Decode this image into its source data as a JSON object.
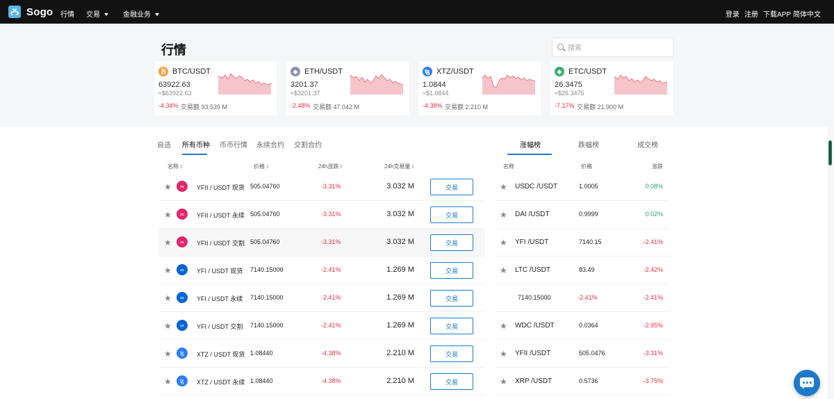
{
  "nav": {
    "brand": "Sogo",
    "items": [
      {
        "label": "行情",
        "caret": false
      },
      {
        "label": "交易",
        "caret": true
      },
      {
        "label": "金融业务",
        "caret": true
      }
    ],
    "right": [
      "登录",
      "注册",
      "下载APP",
      "简体中文"
    ]
  },
  "page": {
    "title": "行情",
    "search_placeholder": "搜索"
  },
  "cards": [
    {
      "pair": "BTC/USDT",
      "price": "63922.63",
      "cny": "≈$63922.63",
      "change": "-4.34%",
      "volume": "交易额 93.539 M",
      "icon": "bitcoin-icon",
      "icon_color": "#f2a13b"
    },
    {
      "pair": "ETH/USDT",
      "price": "3201.37",
      "cny": "≈$3201.37",
      "change": "-2.48%",
      "volume": "交易额 47.042 M",
      "icon": "ethereum-icon",
      "icon_color": "#8a92b2"
    },
    {
      "pair": "XTZ/USDT",
      "price": "1.0844",
      "cny": "≈$1.0844",
      "change": "-4.38%",
      "volume": "交易额 2.210 M",
      "icon": "tezos-icon",
      "icon_color": "#2c7df7"
    },
    {
      "pair": "ETC/USDT",
      "price": "26.3475",
      "cny": "≈$26.3475",
      "change": "-7.17%",
      "volume": "交易额 21.900 M",
      "icon": "etc-icon",
      "icon_color": "#33b073"
    }
  ],
  "tabs": [
    "自选",
    "所有币种",
    "币币行情",
    "永续合约",
    "交割合约"
  ],
  "table": {
    "headers": {
      "name": "名称",
      "price": "价格",
      "change": "24h涨跌",
      "volume": "24h交易量"
    },
    "trade_label": "交易",
    "rows": [
      {
        "pair": "YFII / USDT 现货",
        "price": "505.04760",
        "change": "-3.31%",
        "volume": "3.032 M",
        "icon": "yfii-icon",
        "icon_color": "#e0266e"
      },
      {
        "pair": "YFII / USDT 永续",
        "price": "505.04760",
        "change": "-3.31%",
        "volume": "3.032 M",
        "icon": "yfii-icon",
        "icon_color": "#e0266e"
      },
      {
        "pair": "YFII / USDT 交割",
        "price": "505.04760",
        "change": "-3.31%",
        "volume": "3.032 M",
        "icon": "yfii-icon",
        "icon_color": "#e0266e"
      },
      {
        "pair": "YFI / USDT 现货",
        "price": "7140.15000",
        "change": "-2.41%",
        "volume": "1.269 M",
        "icon": "yfi-icon",
        "icon_color": "#0064d2"
      },
      {
        "pair": "YFI / USDT 永续",
        "price": "7140.15000",
        "change": "-2.41%",
        "volume": "1.269 M",
        "icon": "yfi-icon",
        "icon_color": "#0064d2"
      },
      {
        "pair": "YFI / USDT 交割",
        "price": "7140.15000",
        "change": "-2.41%",
        "volume": "1.269 M",
        "icon": "yfi-icon",
        "icon_color": "#0064d2"
      },
      {
        "pair": "XTZ / USDT 现货",
        "price": "1.08440",
        "change": "-4.38%",
        "volume": "2.210 M",
        "icon": "tezos-icon",
        "icon_color": "#2c7df7"
      },
      {
        "pair": "XTZ / USDT 永续",
        "price": "1.08440",
        "change": "-4.38%",
        "volume": "2.210 M",
        "icon": "tezos-icon",
        "icon_color": "#2c7df7"
      }
    ]
  },
  "ranks": {
    "tabs": [
      "涨幅榜",
      "跌幅榜",
      "成交榜"
    ],
    "headers": {
      "name": "名称",
      "price": "价格",
      "change": "涨跌"
    },
    "rows": [
      {
        "name": "USDC /USDT",
        "price": "1.0005",
        "change": "0.08%",
        "dir": "up",
        "star": true
      },
      {
        "name": "DAI /USDT",
        "price": "0.9999",
        "change": "0.02%",
        "dir": "up",
        "star": true
      },
      {
        "name": "YFI /USDT",
        "price": "7140.15",
        "change": "-2.41%",
        "dir": "down",
        "star": true
      },
      {
        "name": "LTC /USDT",
        "price": "83.49",
        "change": "-2.42%",
        "dir": "down",
        "star": true
      },
      {
        "name": "7140.15000",
        "price": "-2.41%",
        "change": "-2.41%",
        "dir": "down",
        "star": false
      },
      {
        "name": "WDC /USDT",
        "price": "0.0364",
        "change": "-2.95%",
        "dir": "down",
        "star": true
      },
      {
        "name": "YFII /USDT",
        "price": "505.0476",
        "change": "-3.31%",
        "dir": "down",
        "star": true
      },
      {
        "name": "XRP /USDT",
        "price": "0.5736",
        "change": "-3.75%",
        "dir": "down",
        "star": true
      }
    ]
  },
  "colors": {
    "accent": "#1e7ac8",
    "down": "#e0323f",
    "up": "#26a17b",
    "topbar": "#121212"
  }
}
